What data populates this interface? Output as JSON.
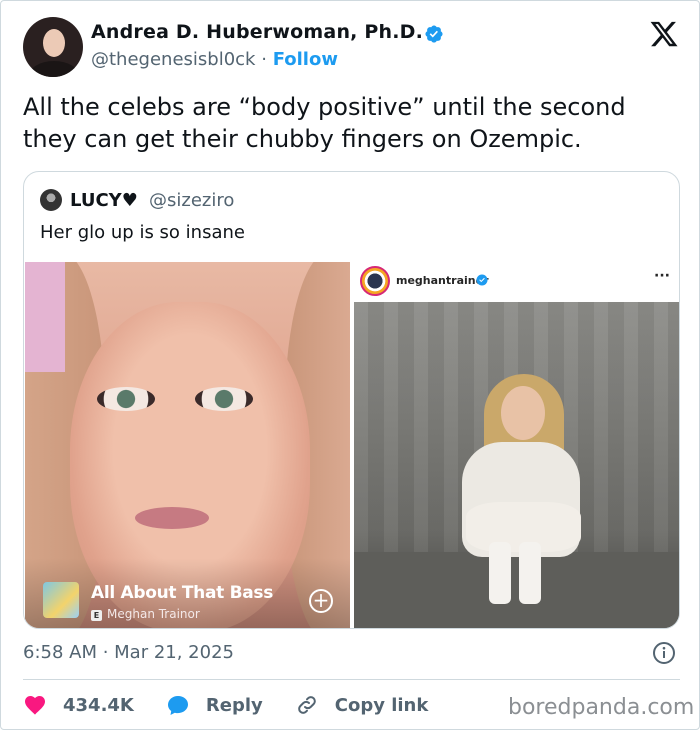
{
  "author": {
    "name": "Andrea D. Huberwoman, Ph.D.",
    "handle": "@thegenesisbl0ck",
    "separator": "·",
    "follow_label": "Follow"
  },
  "tweet": {
    "text": "All the celebs are “body positive” until the second they can get their chubby fingers on Ozempic."
  },
  "quoted": {
    "name": "LUCY♥",
    "handle": "@sizeziro",
    "text": "Her glo up is so insane",
    "song": {
      "title": "All About That Bass",
      "explicit_badge": "E",
      "artist": "Meghan Trainor"
    },
    "instagram": {
      "username": "meghantrainor",
      "more": "···"
    }
  },
  "meta": {
    "timestamp": "6:58 AM · Mar 21, 2025"
  },
  "actions": {
    "likes": "434.4K",
    "reply_label": "Reply",
    "copy_label": "Copy link"
  },
  "watermark": "boredpanda.com",
  "colors": {
    "accent": "#1d9bf0",
    "like": "#f91880",
    "muted": "#536471"
  }
}
